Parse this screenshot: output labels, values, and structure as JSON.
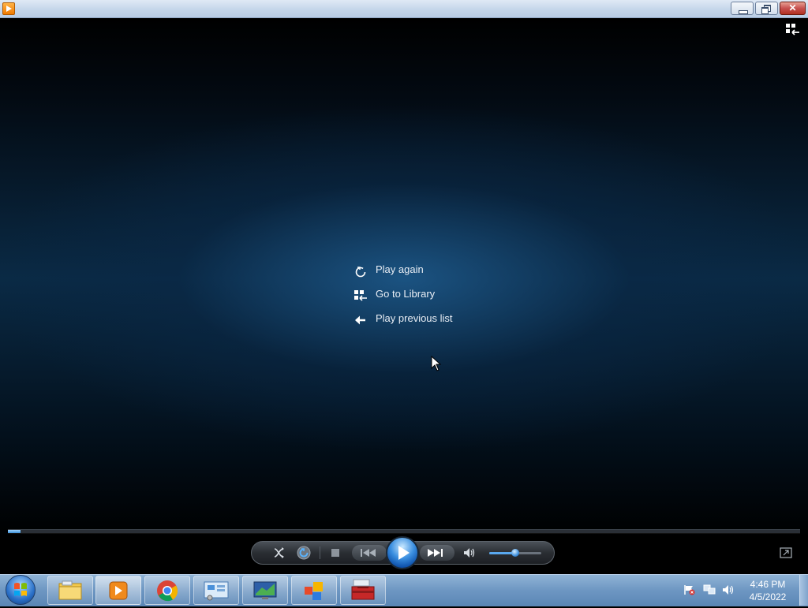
{
  "window": {
    "icon": "media-player-icon",
    "controls": [
      "minimize-icon",
      "restore-icon",
      "close-icon"
    ]
  },
  "video": {
    "switch_icon": "switch-to-library-icon",
    "menu": [
      {
        "icon": "replay-icon",
        "label": "Play again"
      },
      {
        "icon": "library-grid-icon",
        "label": "Go to Library"
      },
      {
        "icon": "back-arrow-icon",
        "label": "Play previous list"
      }
    ]
  },
  "playback": {
    "progress": 0.016,
    "volume": 0.5,
    "buttons": [
      "shuffle-icon",
      "repeat-icon",
      "stop-icon",
      "previous-icon",
      "play-icon",
      "next-icon",
      "volume-icon"
    ],
    "fullscreen_icon": "fullscreen-icon"
  },
  "taskbar": {
    "pinned": [
      "windows-explorer-icon",
      "windows-media-player-icon",
      "chrome-icon",
      "control-panel-icon",
      "remote-desktop-icon",
      "office-icon",
      "toolbox-icon"
    ],
    "tray": [
      "action-center-flag-icon",
      "network-icon",
      "speaker-icon"
    ],
    "time": "4:46 PM",
    "date": "4/5/2022"
  },
  "colors": {
    "accent": "#3b8fe0",
    "taskbar": "#6d96c2"
  }
}
